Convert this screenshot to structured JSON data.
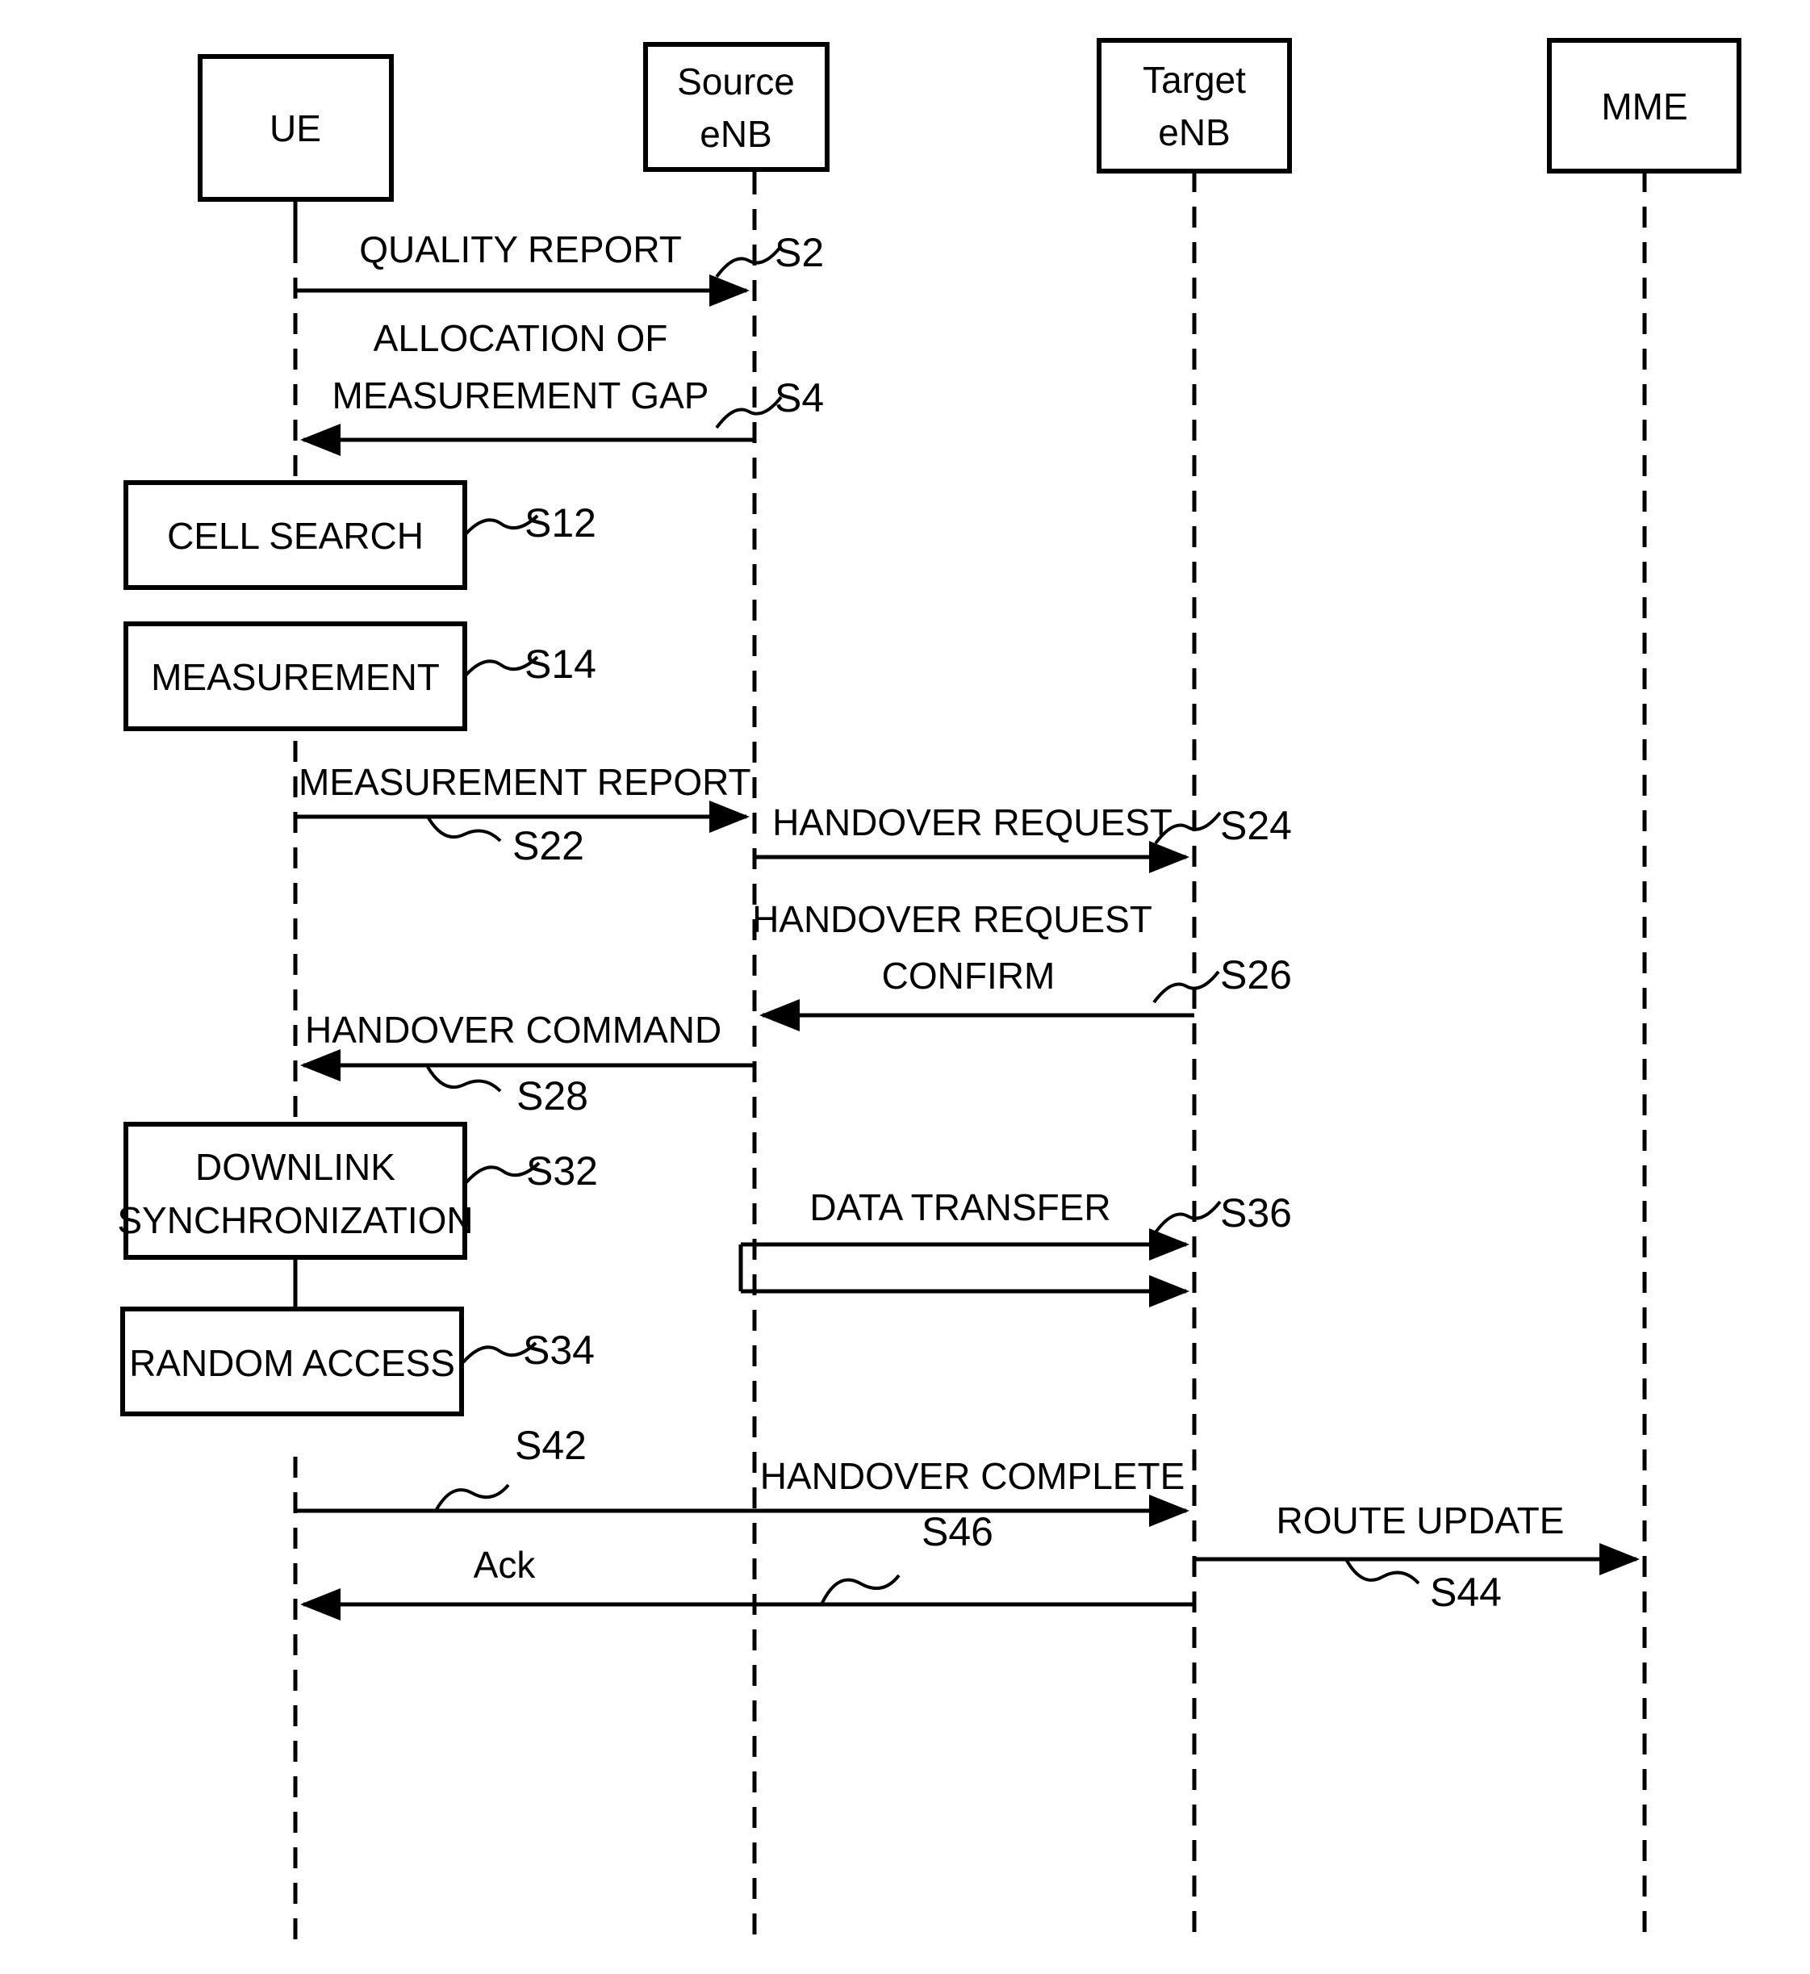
{
  "diagram": {
    "title": "LTE Handover Procedure Sequence Diagram",
    "type": "sequence-diagram",
    "stroke_color": "#000000",
    "background_color": "#ffffff"
  },
  "actors": [
    {
      "id": "ue",
      "label": "UE",
      "lines": [
        "UE"
      ]
    },
    {
      "id": "source_enb",
      "label": "Source eNB",
      "lines": [
        "Source",
        "eNB"
      ]
    },
    {
      "id": "target_enb",
      "label": "Target eNB",
      "lines": [
        "Target",
        "eNB"
      ]
    },
    {
      "id": "mme",
      "label": "MME",
      "lines": [
        "MME"
      ]
    }
  ],
  "messages": [
    {
      "id": "s2",
      "step": "S2",
      "label": "QUALITY REPORT",
      "lines": [
        "QUALITY REPORT"
      ],
      "from": "ue",
      "to": "source_enb",
      "direction": "right"
    },
    {
      "id": "s4",
      "step": "S4",
      "label": "ALLOCATION OF MEASUREMENT GAP",
      "lines": [
        "ALLOCATION OF",
        "MEASUREMENT GAP"
      ],
      "from": "source_enb",
      "to": "ue",
      "direction": "left"
    },
    {
      "id": "s22",
      "step": "S22",
      "label": "MEASUREMENT REPORT",
      "lines": [
        "MEASUREMENT REPORT"
      ],
      "from": "ue",
      "to": "source_enb",
      "direction": "right"
    },
    {
      "id": "s24",
      "step": "S24",
      "label": "HANDOVER REQUEST",
      "lines": [
        "HANDOVER REQUEST"
      ],
      "from": "source_enb",
      "to": "target_enb",
      "direction": "right"
    },
    {
      "id": "s26",
      "step": "S26",
      "label": "HANDOVER REQUEST CONFIRM",
      "lines": [
        "HANDOVER REQUEST",
        "CONFIRM"
      ],
      "from": "target_enb",
      "to": "source_enb",
      "direction": "left"
    },
    {
      "id": "s28",
      "step": "S28",
      "label": "HANDOVER COMMAND",
      "lines": [
        "HANDOVER COMMAND"
      ],
      "from": "source_enb",
      "to": "ue",
      "direction": "left"
    },
    {
      "id": "s36",
      "step": "S36",
      "label": "DATA TRANSFER",
      "lines": [
        "DATA TRANSFER"
      ],
      "from": "source_enb",
      "to": "target_enb",
      "direction": "right",
      "style": "double"
    },
    {
      "id": "s42",
      "step": "S42",
      "label": "HANDOVER COMPLETE",
      "lines": [
        "HANDOVER COMPLETE"
      ],
      "from": "ue",
      "to": "target_enb",
      "direction": "right"
    },
    {
      "id": "s44",
      "step": "S44",
      "label": "ROUTE UPDATE",
      "lines": [
        "ROUTE UPDATE"
      ],
      "from": "target_enb",
      "to": "mme",
      "direction": "right"
    },
    {
      "id": "s46",
      "step": "S46",
      "label": "Ack",
      "lines": [
        "Ack"
      ],
      "from": "target_enb",
      "to": "ue",
      "direction": "left"
    }
  ],
  "processes": [
    {
      "id": "s12",
      "step": "S12",
      "label": "CELL SEARCH",
      "lines": [
        "CELL SEARCH"
      ],
      "actor": "ue"
    },
    {
      "id": "s14",
      "step": "S14",
      "label": "MEASUREMENT",
      "lines": [
        "MEASUREMENT"
      ],
      "actor": "ue"
    },
    {
      "id": "s32",
      "step": "S32",
      "label": "DOWNLINK SYNCHRONIZATION",
      "lines": [
        "DOWNLINK",
        "SYNCHRONIZATION"
      ],
      "actor": "ue"
    },
    {
      "id": "s34",
      "step": "S34",
      "label": "RANDOM ACCESS",
      "lines": [
        "RANDOM ACCESS"
      ],
      "actor": "ue"
    }
  ],
  "step_labels": [
    "S2",
    "S4",
    "S12",
    "S14",
    "S22",
    "S24",
    "S26",
    "S28",
    "S32",
    "S34",
    "S36",
    "S42",
    "S44",
    "S46"
  ]
}
